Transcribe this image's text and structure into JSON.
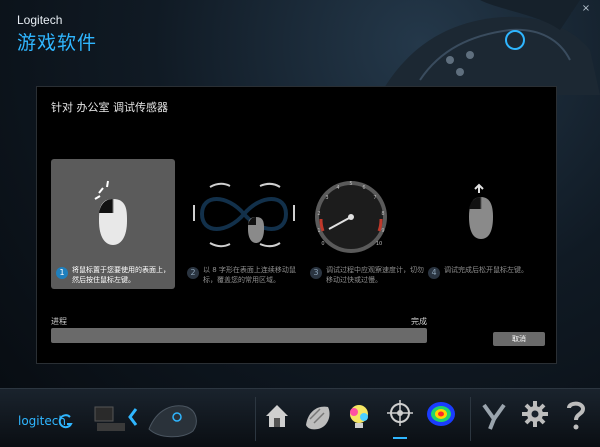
{
  "window": {
    "brand": "Logitech",
    "title": "游戏软件",
    "controls": [
      "–",
      "□",
      "×"
    ]
  },
  "dialog": {
    "title": "针对 办公室 调试传感器",
    "steps": [
      {
        "number": "1",
        "text": "将鼠标置于您要使用的表面上，然后按住鼠标左键。",
        "active": true
      },
      {
        "number": "2",
        "text": "以 8 字形在表面上连续移动鼠标，覆盖您的常用区域。",
        "active": false
      },
      {
        "number": "3",
        "text": "调试过程中应观察速度计，切勿移动过快或过慢。",
        "active": false
      },
      {
        "number": "4",
        "text": "调试完成后松开鼠标左键。",
        "active": false
      }
    ],
    "gauge_ticks": [
      "0",
      "1",
      "2",
      "3",
      "4",
      "5",
      "6",
      "7",
      "8",
      "9",
      "10"
    ],
    "progress": {
      "label": "进程",
      "done_label": "完成",
      "value": 0
    },
    "cancel_label": "取消"
  },
  "toolbar": {
    "logo": "logitech",
    "items": [
      "device-computer-icon",
      "back-arrow-icon",
      "mouse-device-icon",
      "home-icon",
      "customize-buttons-icon",
      "lighting-icon",
      "pointer-settings-icon",
      "heatmap-icon",
      "switch-icon",
      "settings-gear-icon",
      "help-icon"
    ],
    "selected_index": 6
  },
  "colors": {
    "accent": "#2fb6ff",
    "dialog_bg": "#000000",
    "active_step_bg": "#5b5b5b"
  }
}
